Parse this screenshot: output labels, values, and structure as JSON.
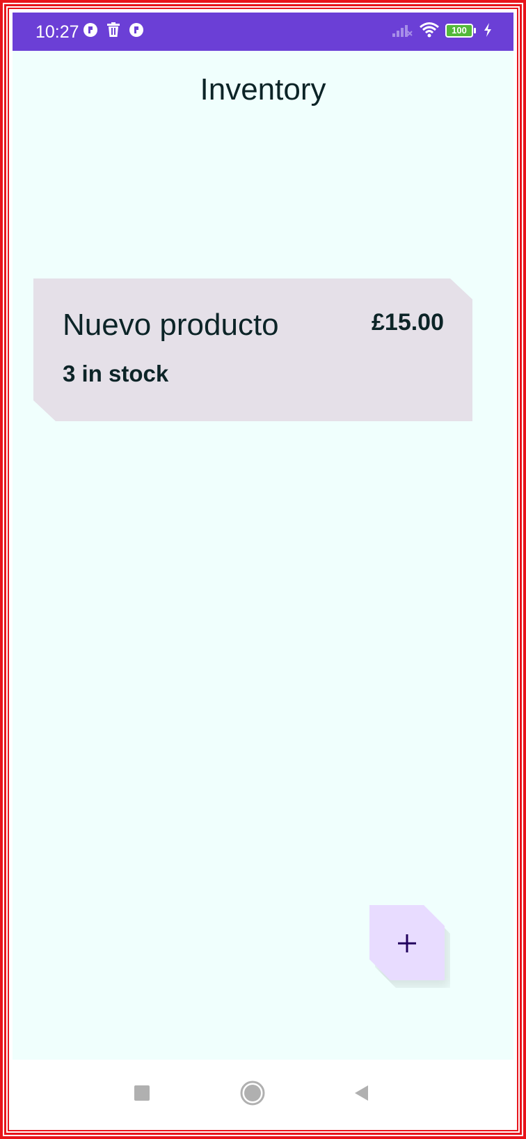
{
  "status_bar": {
    "time": "10:27",
    "battery_level": "100",
    "background_color": "#6b3fd6",
    "left_icons": [
      "app-icon",
      "trash-icon",
      "app-icon"
    ],
    "right_icons": [
      "cellular-signal-icon",
      "wifi-icon",
      "battery-icon",
      "charging-icon"
    ]
  },
  "app_bar": {
    "title": "Inventory"
  },
  "inventory": {
    "items": [
      {
        "name": "Nuevo producto",
        "price": "£15.00",
        "stock": "3 in stock"
      }
    ]
  },
  "fab": {
    "icon": "plus-icon",
    "label": "+"
  },
  "navigation_bar": {
    "buttons": [
      "recents-icon",
      "home-icon",
      "back-icon"
    ]
  },
  "colors": {
    "screen_background": "#f0fffd",
    "card_background": "#e5e0e8",
    "fab_background": "#e8dcff",
    "text": "#0c2427",
    "frame_border": "#e8141b"
  }
}
